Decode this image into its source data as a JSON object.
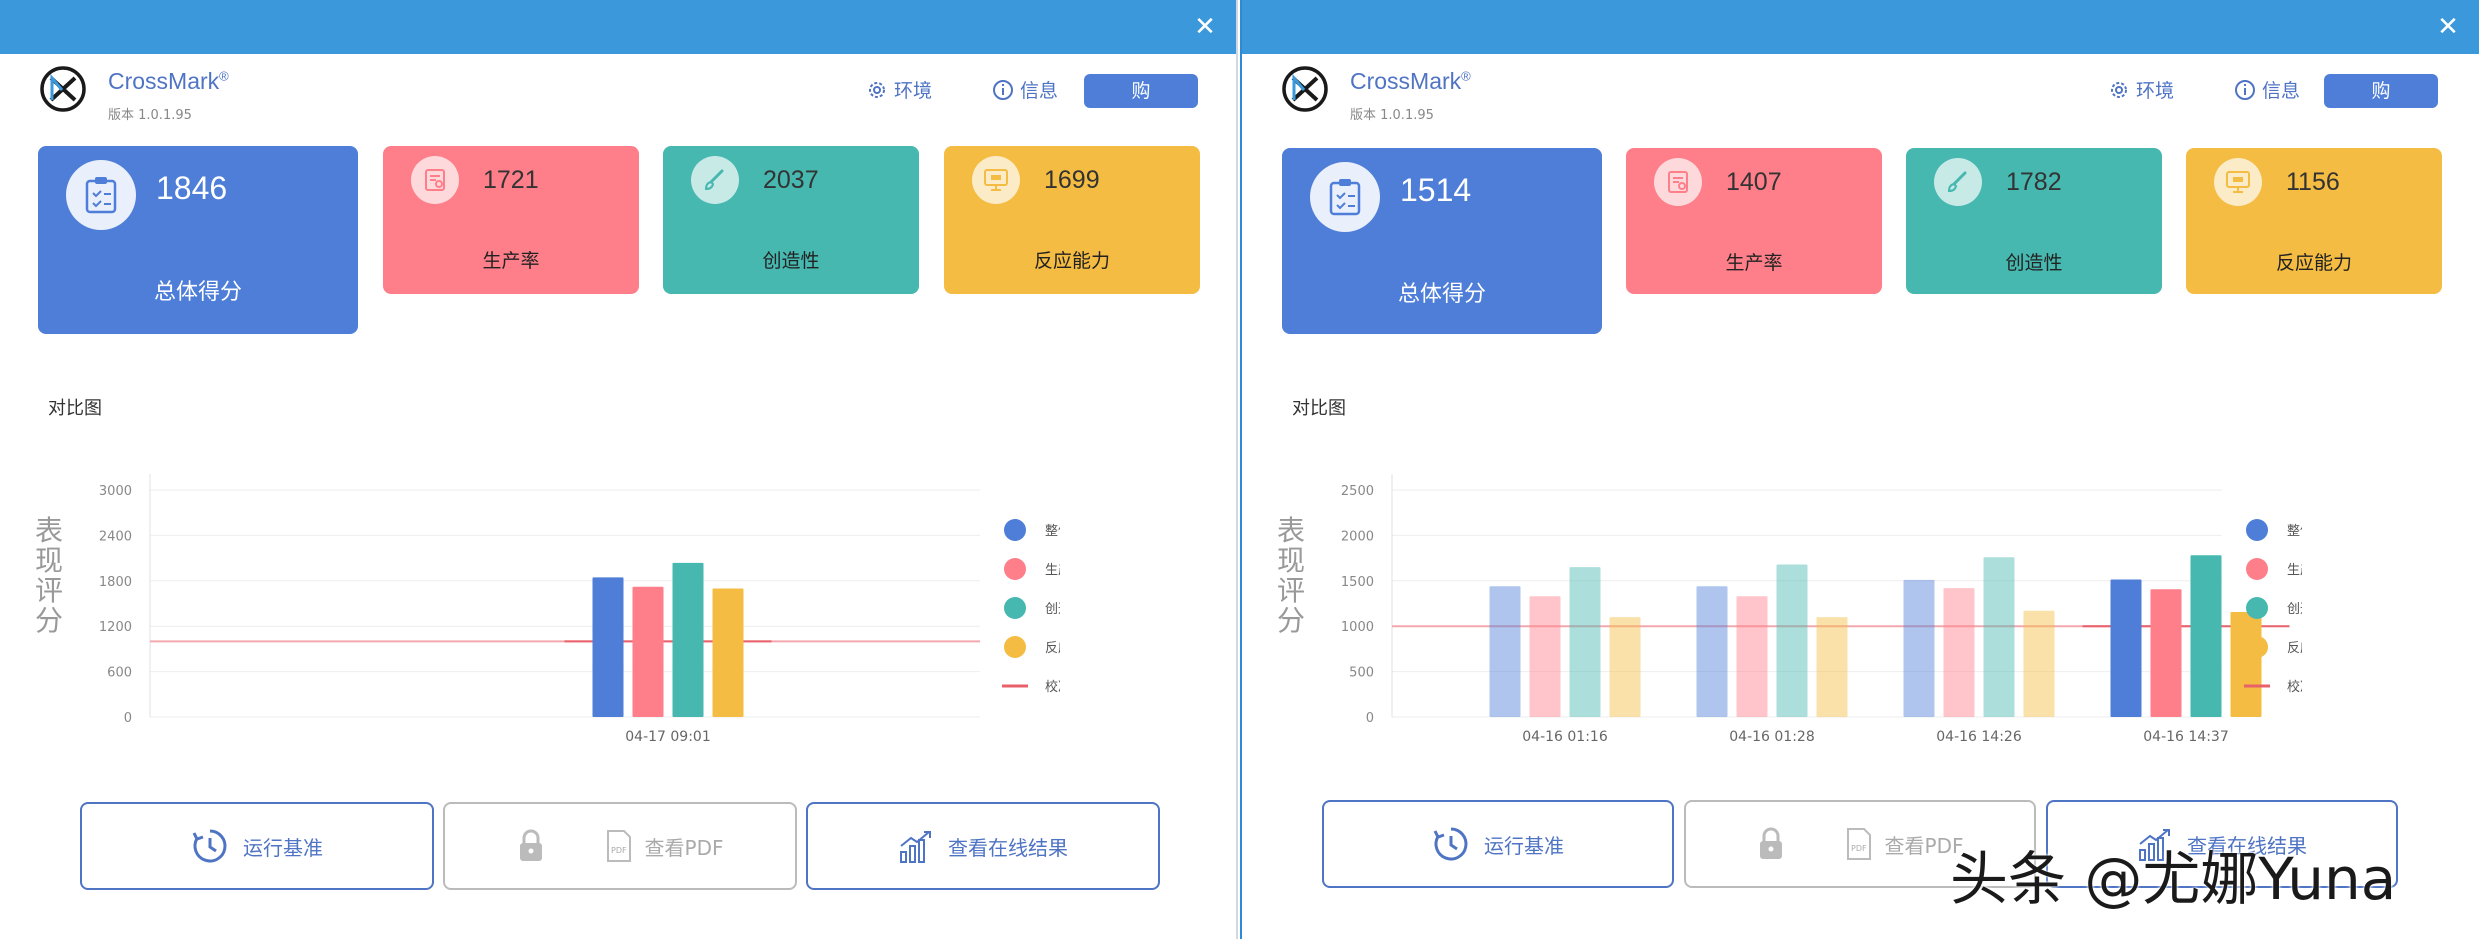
{
  "colors": {
    "titlebar": "#3a98db",
    "overall": "#4e7ed8",
    "productivity": "#fe7f8a",
    "creativity": "#46b8b0",
    "responsiveness": "#f4bc42",
    "accent": "#4f74c4",
    "calibration": "#e8606a"
  },
  "common": {
    "close_glyph": "✕",
    "app_name": "CrossMark",
    "reg_mark": "®",
    "version": "版本 1.0.1.95",
    "nav_env": "环境",
    "nav_info": "信息",
    "buy": "购",
    "overall_label": "总体得分",
    "productivity_label": "生产率",
    "creativity_label": "创造性",
    "responsiveness_label": "反应能力",
    "chart_title": "对比图",
    "ylabel": "表现评分",
    "legend": [
      "整体",
      "生产率",
      "创造性",
      "反应能力",
      "校准"
    ],
    "btn_run": "运行基准",
    "btn_pdf": "查看PDF",
    "btn_online": "查看在线结果",
    "icons": [
      "gear-icon",
      "info-icon",
      "clipboard-icon",
      "document-icon",
      "brush-icon",
      "monitor-icon",
      "clock-icon",
      "lock-icon",
      "pdf-icon",
      "chart-icon",
      "close-icon"
    ]
  },
  "left": {
    "scores": {
      "overall": "1846",
      "productivity": "1721",
      "creativity": "2037",
      "responsiveness": "1699"
    }
  },
  "right": {
    "scores": {
      "overall": "1514",
      "productivity": "1407",
      "creativity": "1782",
      "responsiveness": "1156"
    }
  },
  "chart_data": [
    {
      "type": "bar",
      "title": "对比图",
      "ylabel": "表现评分",
      "yticks": [
        0,
        600,
        1200,
        1800,
        2400,
        3000
      ],
      "ylim": [
        0,
        3000
      ],
      "calibration": 1000,
      "categories": [
        "04-17 09:01"
      ],
      "series": [
        {
          "name": "整体",
          "values": [
            1846
          ]
        },
        {
          "name": "生产率",
          "values": [
            1721
          ]
        },
        {
          "name": "创造性",
          "values": [
            2037
          ]
        },
        {
          "name": "反应能力",
          "values": [
            1699
          ]
        }
      ],
      "faded": [
        false
      ],
      "legend": "right"
    },
    {
      "type": "bar",
      "title": "对比图",
      "ylabel": "表现评分",
      "yticks": [
        0,
        500,
        1000,
        1500,
        2000,
        2500
      ],
      "ylim": [
        0,
        2500
      ],
      "calibration": 1000,
      "categories": [
        "04-16 01:16",
        "04-16 01:28",
        "04-16 14:26",
        "04-16 14:37"
      ],
      "series": [
        {
          "name": "整体",
          "values": [
            1440,
            1440,
            1510,
            1514
          ]
        },
        {
          "name": "生产率",
          "values": [
            1330,
            1330,
            1420,
            1407
          ]
        },
        {
          "name": "创造性",
          "values": [
            1650,
            1680,
            1760,
            1782
          ]
        },
        {
          "name": "反应能力",
          "values": [
            1100,
            1100,
            1170,
            1156
          ]
        }
      ],
      "faded": [
        true,
        true,
        true,
        false
      ],
      "legend": "right"
    }
  ],
  "watermark": "头条 @尤娜Yuna"
}
